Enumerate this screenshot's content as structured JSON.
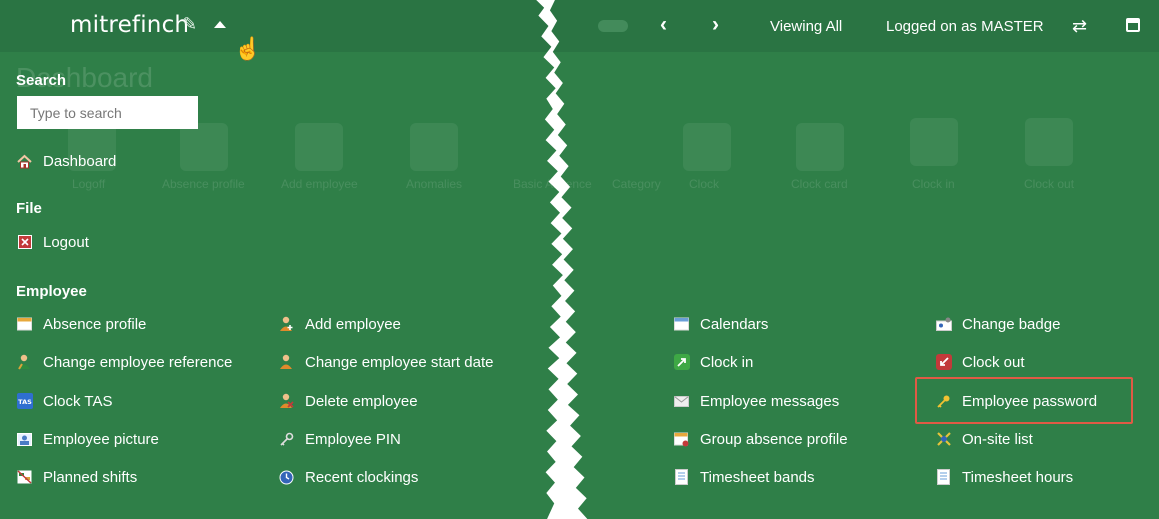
{
  "topbar": {
    "logo_text": "mitrefinch",
    "viewing_label": "Viewing All",
    "logged_on_label": "Logged on as MASTER",
    "back_arrow": "‹",
    "forward_arrow": "›"
  },
  "background": {
    "title": "Dashboard",
    "icon_labels": [
      "Logoff",
      "Absence profile",
      "Add employee",
      "Anomalies",
      "Basic Absence",
      "Category",
      "Clock",
      "Clock card",
      "Clock in",
      "Clock out"
    ]
  },
  "search": {
    "label": "Search",
    "placeholder": "Type to search"
  },
  "dashboard_item": "Dashboard",
  "file": {
    "label": "File",
    "items": [
      "Logout"
    ]
  },
  "employee": {
    "label": "Employee",
    "col1": [
      "Absence profile",
      "Change employee reference",
      "Clock TAS",
      "Employee picture",
      "Planned shifts"
    ],
    "col2": [
      "Add employee",
      "Change employee start date",
      "Delete employee",
      "Employee PIN",
      "Recent clockings"
    ],
    "col3": [
      "Calendars",
      "Clock in",
      "Employee messages",
      "Group absence profile",
      "Timesheet bands"
    ],
    "col4": [
      "Change badge",
      "Clock out",
      "Employee password",
      "On-site list",
      "Timesheet hours"
    ]
  },
  "icons": {
    "tas_badge": "TAS"
  },
  "colors": {
    "background": "#2f7f48",
    "topbar": "#2a7443",
    "highlight": "#e05a45"
  }
}
